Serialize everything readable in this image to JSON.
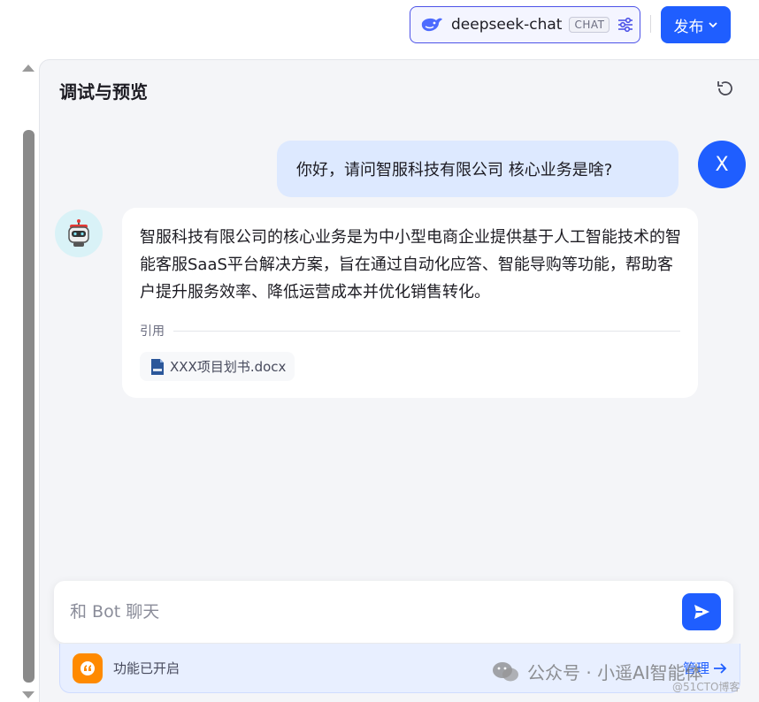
{
  "toolbar": {
    "model_name": "deepseek-chat",
    "model_tag": "CHAT",
    "publish_label": "发布"
  },
  "panel": {
    "title": "调试与预览"
  },
  "conversation": {
    "user_avatar_letter": "X",
    "user_message": "你好，请问智服科技有限公司 核心业务是啥?",
    "bot_message": "智服科技有限公司的核心业务是为中小型电商企业提供基于人工智能技术的智能客服SaaS平台解决方案，旨在通过自动化应答、智能导购等功能，帮助客户提升服务效率、降低运营成本并优化销售转化。",
    "reference_label": "引用",
    "reference_file": "XXX项目划书.docx"
  },
  "input": {
    "placeholder": "和 Bot 聊天"
  },
  "feature_bar": {
    "status_text": "功能已开启",
    "manage_label": "管理"
  },
  "watermark": {
    "text": "公众号 · 小遥AI智能体",
    "sub_text": "@51CTO博客"
  },
  "colors": {
    "primary": "#1f5eff",
    "user_bubble": "#dde9ff",
    "feature_icon": "#ff8a00"
  }
}
